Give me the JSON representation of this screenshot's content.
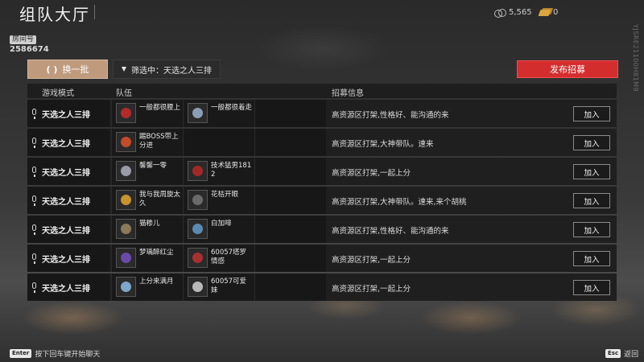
{
  "header": {
    "title": "组队大厅",
    "room_label": "房间号",
    "room_number": "2586674",
    "coins": "5,565",
    "gold": "0",
    "side_text": "YJSRE21100H81M9"
  },
  "toolbar": {
    "refresh_label": "换一批",
    "filter_label": "筛选中：天选之人三排",
    "publish_label": "发布招募"
  },
  "table": {
    "headers": {
      "mode": "游戏模式",
      "team": "队伍",
      "info": "招募信息"
    },
    "join_label": "加入",
    "rows": [
      {
        "mode": "天选之人三排",
        "members": [
          "一般都很腰上",
          "一般都很着走"
        ],
        "info": "高资源区打架,性格好、能沟通的来",
        "colors": [
          "#b22a2a",
          "#8b9db5"
        ]
      },
      {
        "mode": "天选之人三排",
        "members": [
          "踢BOSS带上分进"
        ],
        "info": "高资源区打架,大神带队。速来",
        "colors": [
          "#c24b2a"
        ]
      },
      {
        "mode": "天选之人三排",
        "members": [
          "馨馨一零",
          "技术猛男1812"
        ],
        "info": "高资源区打架,一起上分",
        "colors": [
          "#9a9aa8",
          "#a22828"
        ]
      },
      {
        "mode": "天选之人三排",
        "members": [
          "我与我周旋太久",
          "花枯开眼"
        ],
        "info": "高资源区打架,大神带队。速来,来个胡桃",
        "colors": [
          "#c8922e",
          "#6a6a6a"
        ]
      },
      {
        "mode": "天选之人三排",
        "members": [
          "猫糁儿",
          "白加啡"
        ],
        "info": "高资源区打架,性格好、能沟通的来",
        "colors": [
          "#8a7a5a",
          "#5a8ab0"
        ]
      },
      {
        "mode": "天选之人三排",
        "members": [
          "梦瑀醉红尘",
          "60057塔罗情感"
        ],
        "info": "高资源区打架,一起上分",
        "colors": [
          "#6a4aa8",
          "#a83030"
        ]
      },
      {
        "mode": "天选之人三排",
        "members": [
          "上分来满月",
          "60057可爱妹"
        ],
        "info": "高资源区打架,一起上分",
        "colors": [
          "#7fa5c8",
          "#b8b8b8"
        ]
      }
    ]
  },
  "footer": {
    "enter_key": "Enter",
    "enter_text": "按下回车键开始聊天",
    "esc_key": "Esc",
    "esc_text": "返回"
  }
}
